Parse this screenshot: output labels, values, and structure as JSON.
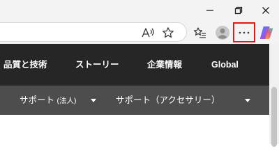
{
  "window_controls": {
    "minimize_icon": "minimize-icon",
    "restore_icon": "restore-icon",
    "close_icon": "close-icon"
  },
  "toolbar": {
    "read_aloud_icon": "read-aloud-icon",
    "favorite_icon": "star-icon",
    "favorites_icon": "favorites-collection-icon",
    "profile_icon": "profile-avatar-icon",
    "more_label": "···",
    "copilot_icon": "copilot-icon",
    "highlight_color": "#e3161a"
  },
  "site_nav": {
    "items": [
      {
        "label": "品質と技術"
      },
      {
        "label": "ストーリー"
      },
      {
        "label": "企業情報"
      },
      {
        "label": "Global"
      }
    ],
    "background": "#262626"
  },
  "sub_nav": {
    "items": [
      {
        "label": "サポート",
        "suffix": "(法人)"
      },
      {
        "label": "サポート（アクセサリー）"
      }
    ],
    "background": "#4d4d4d"
  }
}
